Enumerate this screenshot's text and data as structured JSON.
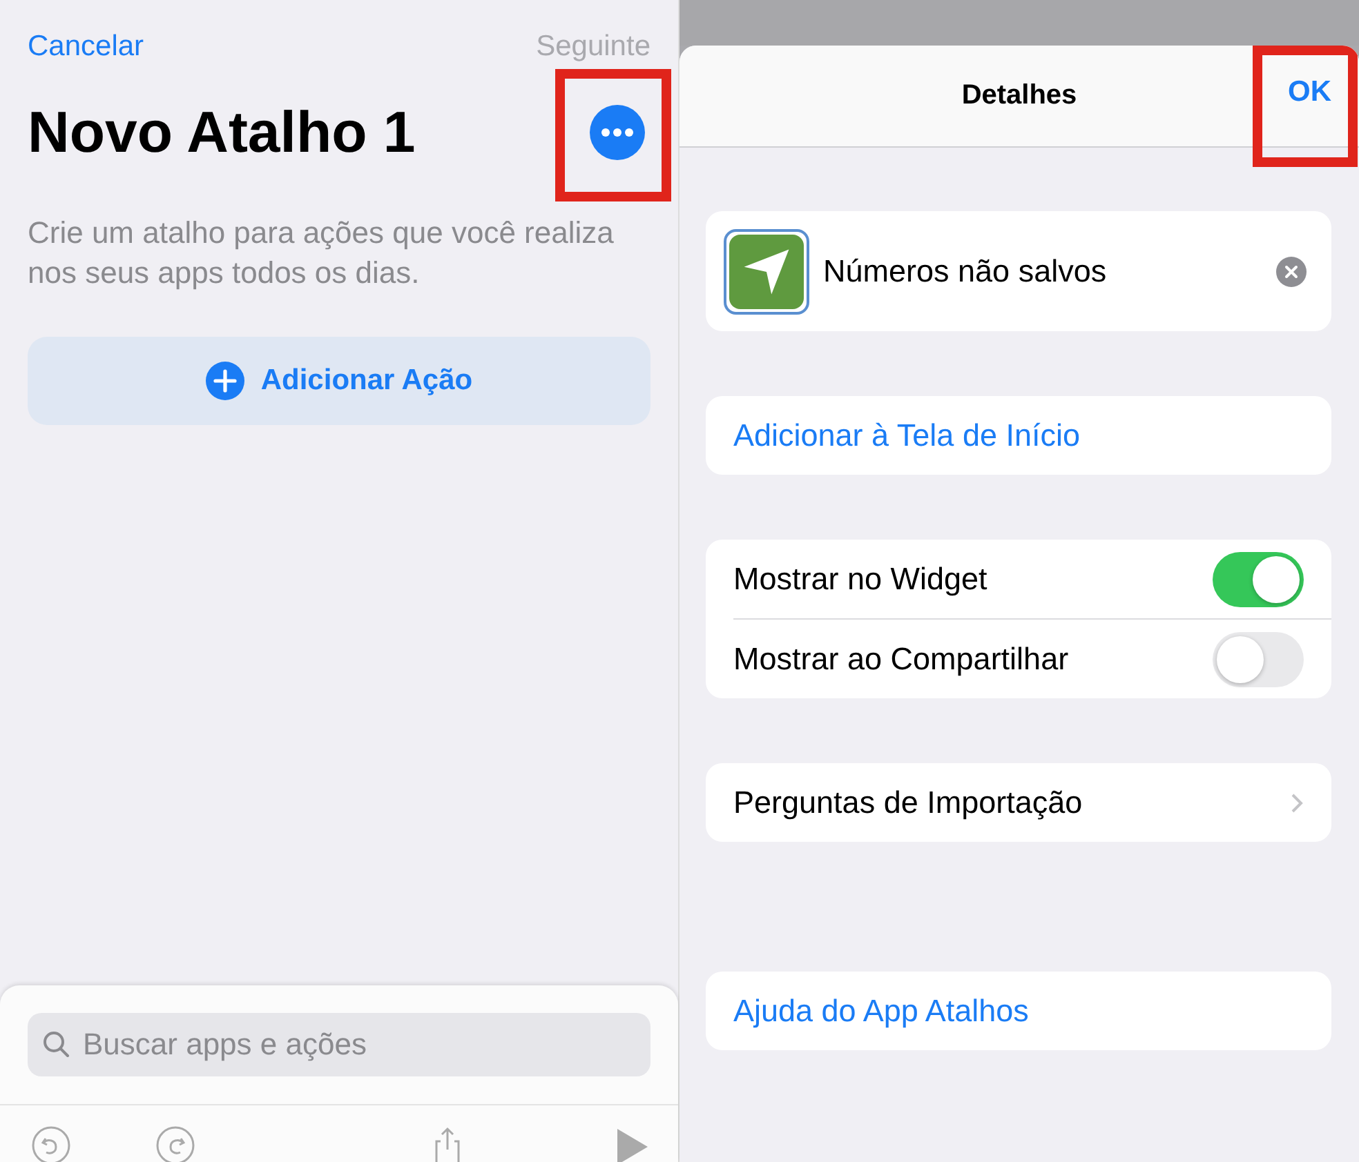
{
  "editor": {
    "cancel": "Cancelar",
    "next": {
      "label": "Seguinte",
      "disabled": true
    },
    "title": "Novo Atalho 1",
    "more_button": {
      "highlighted": true
    },
    "description": "Crie um atalho para ações que você realiza nos seus apps todos os dias.",
    "add_action": "Adicionar Ação",
    "search": {
      "placeholder": "Buscar apps e ações"
    }
  },
  "details": {
    "title": "Detalhes",
    "ok": {
      "label": "OK",
      "highlighted": true
    },
    "shortcut_name": "Números não salvos",
    "add_home": "Adicionar à Tela de Início",
    "toggles": [
      {
        "label": "Mostrar no Widget",
        "on": true
      },
      {
        "label": "Mostrar ao Compartilhar",
        "on": false
      }
    ],
    "import_questions": "Perguntas de Importação",
    "help": "Ajuda do App Atalhos"
  }
}
